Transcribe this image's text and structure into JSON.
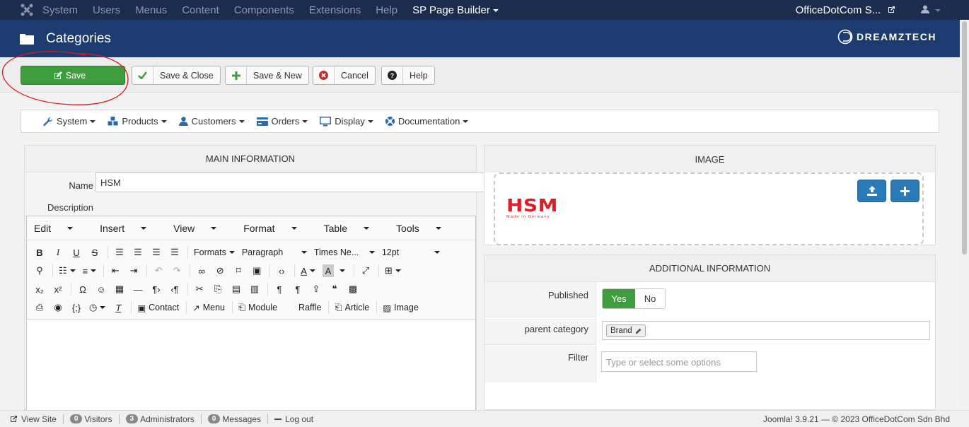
{
  "topnav": {
    "items": [
      "System",
      "Users",
      "Menus",
      "Content",
      "Components",
      "Extensions",
      "Help"
    ],
    "sp_page_builder": "SP Page Builder",
    "site_name": "OfficeDotCom S...",
    "colors": {
      "bg": "#1b2c4e",
      "muted_text": "#8a96ad"
    }
  },
  "header": {
    "title": "Categories",
    "brand": "DREAMZTECH",
    "bg_color": "#1c3b6f"
  },
  "toolbar": {
    "save": "Save",
    "save_close": "Save & Close",
    "save_new": "Save & New",
    "cancel": "Cancel",
    "help": "Help",
    "save_color": "#3f9c3f"
  },
  "submenu": {
    "items": [
      "System",
      "Products",
      "Customers",
      "Orders",
      "Display",
      "Documentation"
    ]
  },
  "main_info": {
    "heading": "MAIN INFORMATION",
    "name_label": "Name",
    "name_value": "HSM",
    "description_label": "Description"
  },
  "editor": {
    "menus": [
      "Edit",
      "Insert",
      "View",
      "Format",
      "Table",
      "Tools"
    ],
    "formats": "Formats",
    "paragraph": "Paragraph",
    "font": "Times Ne...",
    "size": "12pt",
    "buttons": {
      "contact": "Contact",
      "menu": "Menu",
      "module": "Module",
      "raffle": "Raffle",
      "article": "Article",
      "image": "Image"
    }
  },
  "image_panel": {
    "heading": "IMAGE",
    "logo_text": "HSM",
    "logo_sub": "Made in Germany"
  },
  "additional_info": {
    "heading": "ADDITIONAL INFORMATION",
    "published_label": "Published",
    "yes": "Yes",
    "no": "No",
    "published_value": "Yes",
    "parent_label": "parent category",
    "parent_value": "Brand",
    "filter_label": "Filter",
    "filter_placeholder": "Type or select some options"
  },
  "statusbar": {
    "view_site": "View Site",
    "visitors_count": "0",
    "visitors": "Visitors",
    "admins_count": "3",
    "admins": "Administrators",
    "messages_count": "0",
    "messages": "Messages",
    "logout": "Log out",
    "copyright": "Joomla! 3.9.21 — © 2023 OfficeDotCom Sdn Bhd"
  }
}
